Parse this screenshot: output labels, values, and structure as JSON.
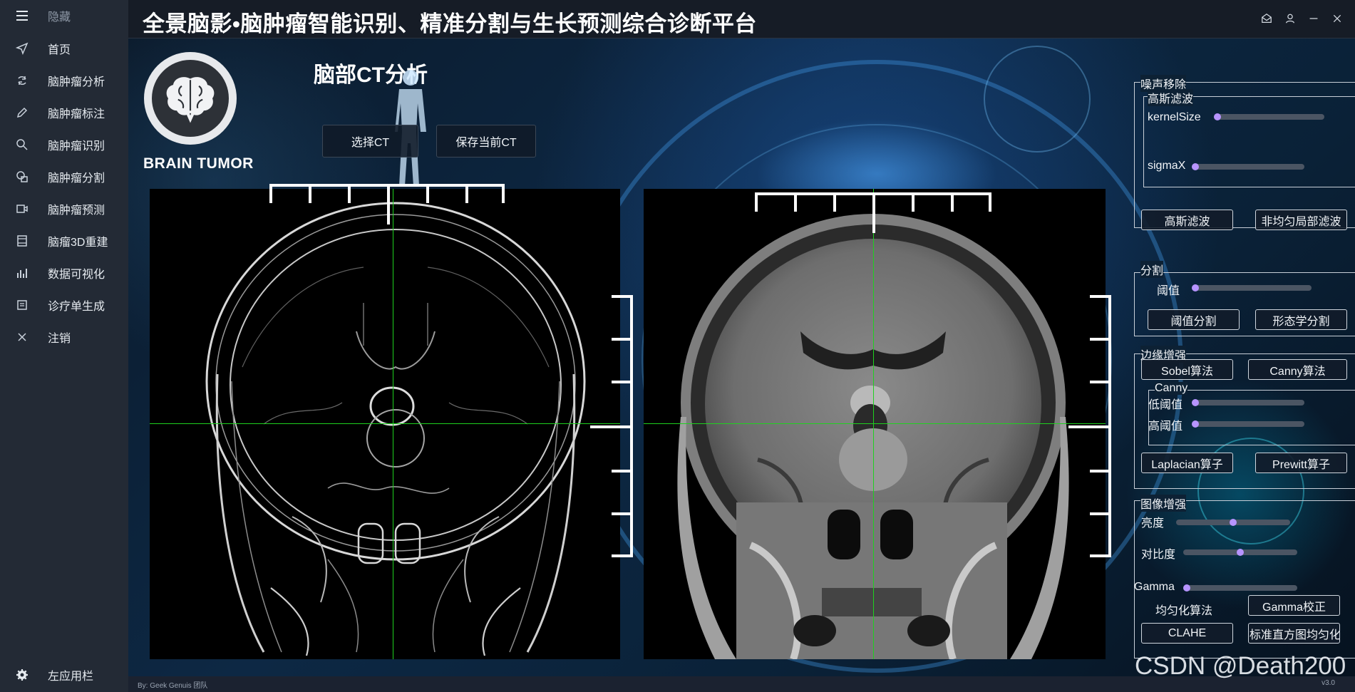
{
  "app": {
    "title": "全景脑影•脑肿瘤智能识别、精准分割与生长预测综合诊断平台",
    "section_title": "脑部CT分析",
    "brand": "BRAIN TUMOR",
    "status_left": "By: Geek Genuis 团队",
    "version": "v3.0",
    "watermark": "CSDN @Death200"
  },
  "sidebar": {
    "toggle_label": "隐藏",
    "items": [
      {
        "label": "首页",
        "icon": "send-icon"
      },
      {
        "label": "脑肿瘤分析",
        "icon": "refresh-icon"
      },
      {
        "label": "脑肿瘤标注",
        "icon": "pencil-icon"
      },
      {
        "label": "脑肿瘤识别",
        "icon": "search-icon"
      },
      {
        "label": "脑肿瘤分割",
        "icon": "shapes-icon"
      },
      {
        "label": "脑肿瘤预测",
        "icon": "video-icon"
      },
      {
        "label": "脑瘤3D重建",
        "icon": "film-icon"
      },
      {
        "label": "数据可视化",
        "icon": "bar-chart-icon"
      },
      {
        "label": "诊疗单生成",
        "icon": "document-icon"
      },
      {
        "label": "注销",
        "icon": "close-icon"
      }
    ],
    "footer_label": "左应用栏"
  },
  "toolbar": {
    "select_ct": "选择CT",
    "save_ct": "保存当前CT"
  },
  "panel": {
    "noise": {
      "title": "噪声移除",
      "gauss_group": "高斯滤波",
      "kernel_label": "kernelSize",
      "kernel_value": 0.0,
      "sigma_label": "sigmaX",
      "sigma_value": 0.0,
      "gauss_button": "高斯滤波",
      "nonlocal_button": "非均匀局部滤波"
    },
    "segment": {
      "title": "分割",
      "threshold_label": "阈值",
      "threshold_value": 0.0,
      "threshold_button": "阈值分割",
      "morph_button": "形态学分割"
    },
    "edge": {
      "title": "边缘增强",
      "sobel_button": "Sobel算法",
      "canny_button": "Canny算法",
      "canny_group": "Canny",
      "low_label": "低阈值",
      "low_value": 0.0,
      "high_label": "高阈值",
      "high_value": 0.0,
      "laplacian_button": "Laplacian算子",
      "prewitt_button": "Prewitt算子"
    },
    "enhance": {
      "title": "图像增强",
      "brightness_label": "亮度",
      "brightness_value": 0.5,
      "contrast_label": "对比度",
      "contrast_value": 0.5,
      "gamma_label": "Gamma",
      "gamma_value": 0.0,
      "gamma_button": "Gamma校正",
      "equalize_label": "均匀化算法",
      "clahe_button": "CLAHE",
      "histeq_button": "标准直方图均匀化"
    }
  }
}
